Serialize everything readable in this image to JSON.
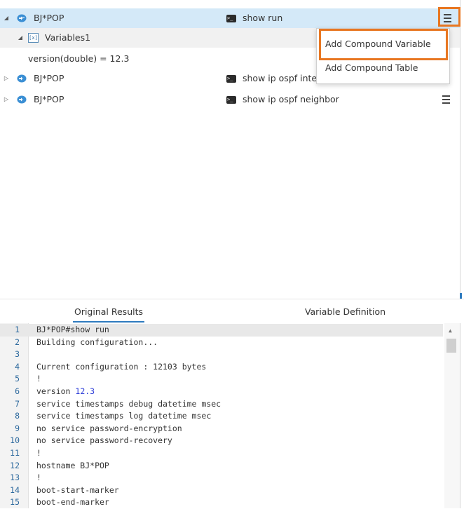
{
  "tree": {
    "rows": [
      {
        "toggle": "◢",
        "device": "BJ*POP",
        "command": "show run",
        "cli_icon": ">_"
      },
      {
        "toggle": "▷",
        "device": "BJ*POP",
        "command": "show ip ospf inte",
        "cli_icon": ">_"
      },
      {
        "toggle": "▷",
        "device": "BJ*POP",
        "command": "show ip ospf neighbor",
        "cli_icon": ">_"
      }
    ],
    "variables_node": {
      "toggle": "◢",
      "icon": "[x]",
      "label": "Variables1"
    },
    "variable_entry": "version(double) = 12.3"
  },
  "context_menu": {
    "items": [
      "Add Compound Variable",
      "Add Compound Table"
    ]
  },
  "tabs": [
    "Original Results",
    "Variable Definition"
  ],
  "code_lines": [
    {
      "n": "1",
      "pre": "BJ*POP#show run",
      "num": "",
      "post": ""
    },
    {
      "n": "2",
      "pre": "Building configuration...",
      "num": "",
      "post": ""
    },
    {
      "n": "3",
      "pre": "",
      "num": "",
      "post": ""
    },
    {
      "n": "4",
      "pre": "Current configuration : 12103 bytes",
      "num": "",
      "post": ""
    },
    {
      "n": "5",
      "pre": "!",
      "num": "",
      "post": ""
    },
    {
      "n": "6",
      "pre": "version ",
      "num": "12.3",
      "post": ""
    },
    {
      "n": "7",
      "pre": "service timestamps debug datetime msec",
      "num": "",
      "post": ""
    },
    {
      "n": "8",
      "pre": "service timestamps log datetime msec",
      "num": "",
      "post": ""
    },
    {
      "n": "9",
      "pre": "no service password-encryption",
      "num": "",
      "post": ""
    },
    {
      "n": "10",
      "pre": "no service password-recovery",
      "num": "",
      "post": ""
    },
    {
      "n": "11",
      "pre": "!",
      "num": "",
      "post": ""
    },
    {
      "n": "12",
      "pre": "hostname BJ*POP",
      "num": "",
      "post": ""
    },
    {
      "n": "13",
      "pre": "!",
      "num": "",
      "post": ""
    },
    {
      "n": "14",
      "pre": "boot-start-marker",
      "num": "",
      "post": ""
    },
    {
      "n": "15",
      "pre": "boot-end-marker",
      "num": "",
      "post": ""
    }
  ],
  "colors": {
    "selected_row": "#d4e9f8",
    "highlight_orange": "#e87722",
    "tab_accent": "#2e7bbf",
    "number_blue": "#2e3ed8"
  },
  "icons": {
    "device": "network-device-icon",
    "cli": "terminal-icon",
    "menu": "hamburger-menu-icon",
    "variables": "variable-icon",
    "scroll_up": "▲"
  }
}
